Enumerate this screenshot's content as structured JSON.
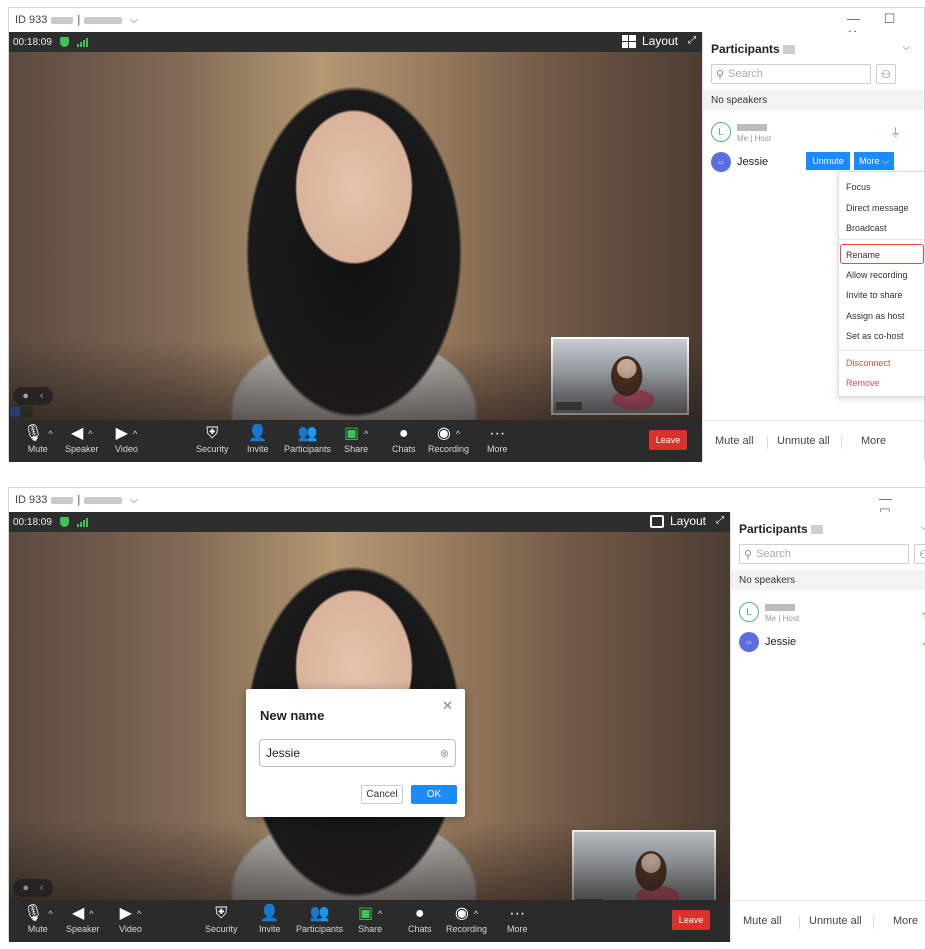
{
  "window": {
    "meeting_id_prefix": "ID 933",
    "separator": "|",
    "dropdown_icon": "chevron-down-icon",
    "controls": [
      "—",
      "☐",
      "✕"
    ]
  },
  "meeting": {
    "timer": "00:18:09",
    "layout_label": "Layout"
  },
  "toolbar": {
    "mute": "Mute",
    "speaker": "Speaker",
    "video": "Video",
    "security": "Security",
    "invite": "Invite",
    "participants": "Participants",
    "share": "Share",
    "chats": "Chats",
    "recording": "Recording",
    "more": "More",
    "leave": "Leave"
  },
  "panel": {
    "title": "Participants",
    "search_placeholder": "Search",
    "no_speakers": "No speakers",
    "host_initial": "L",
    "host_role": "Me | Host",
    "guest_name": "Jessie",
    "unmute": "Unmute",
    "more": "More",
    "footer": {
      "mute_all": "Mute all",
      "unmute_all": "Unmute all",
      "more": "More"
    }
  },
  "context_menu": {
    "items": [
      "Focus",
      "Direct message",
      "Broadcast",
      "Rename",
      "Allow recording",
      "Invite to share",
      "Assign as host",
      "Set as co-host",
      "Disconnect",
      "Remove"
    ]
  },
  "rename_dialog": {
    "title": "New name",
    "value": "Jessie",
    "cancel": "Cancel",
    "ok": "OK"
  },
  "colors": {
    "accent": "#1a8cff",
    "leave": "#d9312b",
    "danger": "#e04b4b",
    "secure": "#3cc35a"
  }
}
